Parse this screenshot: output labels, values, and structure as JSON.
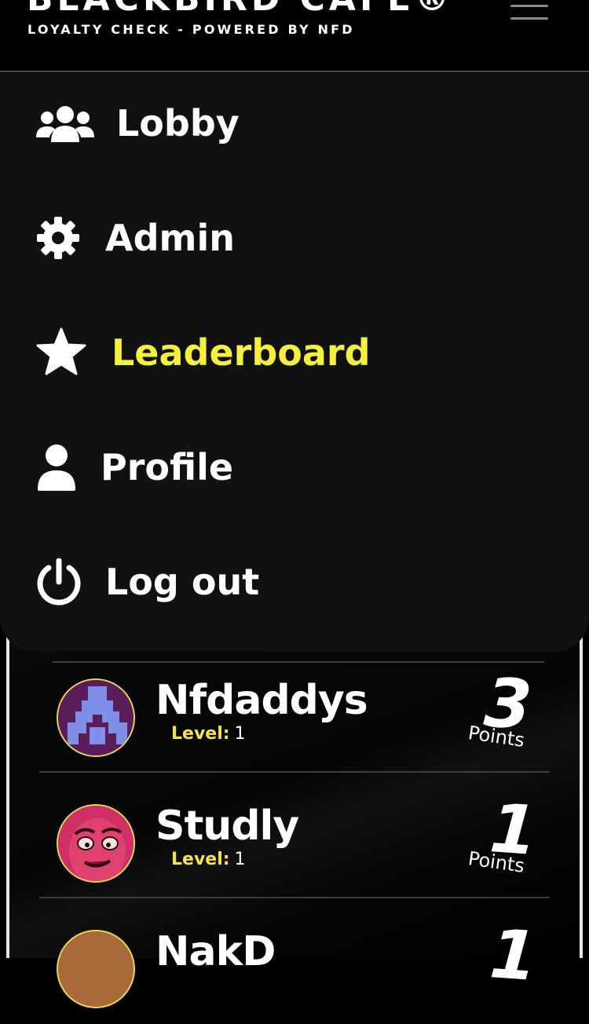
{
  "header": {
    "brand": "BLACKBIRD CAFE®",
    "tagline": "LOYALTY CHECK - POWERED BY NFD"
  },
  "menu": {
    "items": [
      {
        "label": "Lobby",
        "icon": "users-icon"
      },
      {
        "label": "Admin",
        "icon": "gear-icon"
      },
      {
        "label": "Leaderboard",
        "icon": "star-icon",
        "active": true
      },
      {
        "label": "Profile",
        "icon": "user-icon"
      },
      {
        "label": "Log out",
        "icon": "power-icon"
      }
    ],
    "active_color": "#f5f03c"
  },
  "leaderboard": {
    "rows": [
      {
        "name": "Nfdaddys",
        "level_label": "Level:",
        "level": "1",
        "points": "3",
        "points_label": "Points"
      },
      {
        "name": "Studly",
        "level_label": "Level:",
        "level": "1",
        "points": "1",
        "points_label": "Points"
      },
      {
        "name": "NakD",
        "points": "1"
      }
    ]
  }
}
